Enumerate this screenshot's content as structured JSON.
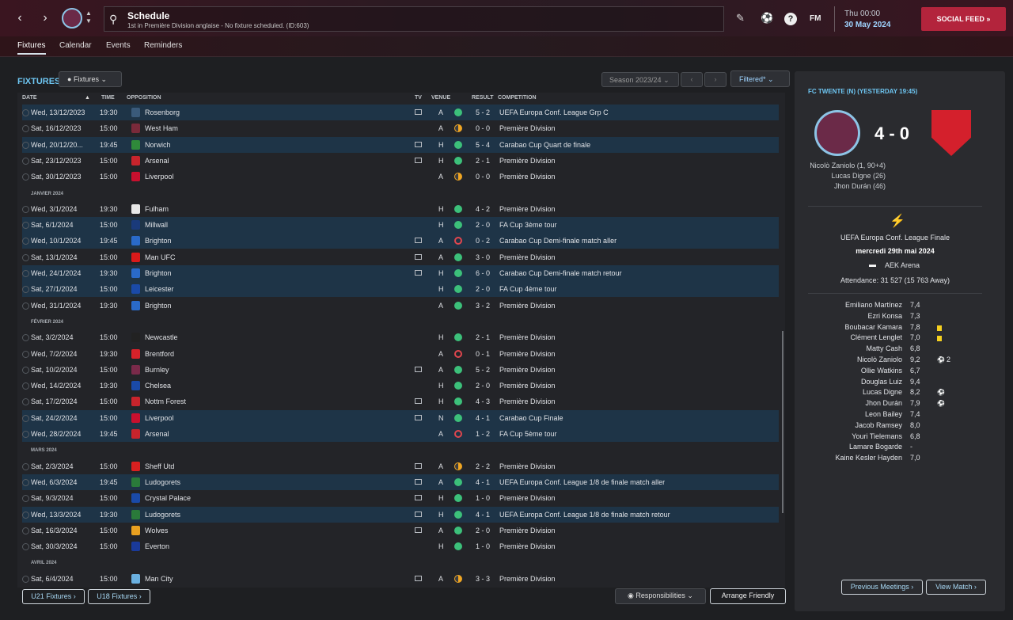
{
  "header": {
    "title": "Schedule",
    "subtitle": "1st in Première Division anglaise - No fixture scheduled. (ID:603)",
    "time": "Thu 00:00",
    "date": "30 May 2024",
    "social_feed": "SOCIAL FEED",
    "fm": "FM",
    "help": "?"
  },
  "tabs": [
    "Fixtures",
    "Calendar",
    "Events",
    "Reminders"
  ],
  "fixtures": {
    "title": "FIXTURES",
    "dropdown": "Fixtures",
    "season": "Season 2023/24",
    "filtered": "Filtered*",
    "columns": [
      "DATE",
      "TIME",
      "OPPOSITION",
      "TV",
      "VENUE",
      "RESULT",
      "COMPETITION"
    ],
    "rows": [
      {
        "date": "Wed, 13/12/2023",
        "time": "19:30",
        "opp": "Rosenborg",
        "tv": true,
        "venue": "A",
        "res": "w",
        "score": "5 - 2",
        "comp": "UEFA Europa Conf. League Grp C",
        "hl": true,
        "badge": "#3a5a7a"
      },
      {
        "date": "Sat, 16/12/2023",
        "time": "15:00",
        "opp": "West Ham",
        "tv": false,
        "venue": "A",
        "res": "d",
        "score": "0 - 0",
        "comp": "Première Division",
        "hl": false,
        "badge": "#7a2a3a"
      },
      {
        "date": "Wed, 20/12/20...",
        "time": "19:45",
        "opp": "Norwich",
        "tv": true,
        "venue": "H",
        "res": "w",
        "score": "5 - 4",
        "comp": "Carabao Cup Quart de finale",
        "hl": true,
        "badge": "#2f8a3a"
      },
      {
        "date": "Sat, 23/12/2023",
        "time": "15:00",
        "opp": "Arsenal",
        "tv": true,
        "venue": "H",
        "res": "w",
        "score": "2 - 1",
        "comp": "Première Division",
        "hl": false,
        "badge": "#c8242c"
      },
      {
        "date": "Sat, 30/12/2023",
        "time": "15:00",
        "opp": "Liverpool",
        "tv": false,
        "venue": "A",
        "res": "d",
        "score": "0 - 0",
        "comp": "Première Division",
        "hl": false,
        "badge": "#c8102e"
      },
      {
        "section": "JANVIER 2024"
      },
      {
        "date": "Wed, 3/1/2024",
        "time": "19:30",
        "opp": "Fulham",
        "tv": false,
        "venue": "H",
        "res": "w",
        "score": "4 - 2",
        "comp": "Première Division",
        "hl": false,
        "badge": "#e8e8e8"
      },
      {
        "date": "Sat, 6/1/2024",
        "time": "15:00",
        "opp": "Millwall",
        "tv": false,
        "venue": "H",
        "res": "w",
        "score": "2 - 0",
        "comp": "FA Cup 3ème tour",
        "hl": true,
        "badge": "#1a3a7a"
      },
      {
        "date": "Wed, 10/1/2024",
        "time": "19:45",
        "opp": "Brighton",
        "tv": true,
        "venue": "A",
        "res": "l",
        "score": "0 - 2",
        "comp": "Carabao Cup Demi-finale match aller",
        "hl": true,
        "badge": "#2a6ac8"
      },
      {
        "date": "Sat, 13/1/2024",
        "time": "15:00",
        "opp": "Man UFC",
        "tv": true,
        "venue": "A",
        "res": "w",
        "score": "3 - 0",
        "comp": "Première Division",
        "hl": false,
        "badge": "#da1a1a"
      },
      {
        "date": "Wed, 24/1/2024",
        "time": "19:30",
        "opp": "Brighton",
        "tv": true,
        "venue": "H",
        "res": "w",
        "score": "6 - 0",
        "comp": "Carabao Cup Demi-finale match retour",
        "hl": true,
        "badge": "#2a6ac8"
      },
      {
        "date": "Sat, 27/1/2024",
        "time": "15:00",
        "opp": "Leicester",
        "tv": false,
        "venue": "H",
        "res": "w",
        "score": "2 - 0",
        "comp": "FA Cup 4ème tour",
        "hl": true,
        "badge": "#1a4aa8"
      },
      {
        "date": "Wed, 31/1/2024",
        "time": "19:30",
        "opp": "Brighton",
        "tv": false,
        "venue": "A",
        "res": "w",
        "score": "3 - 2",
        "comp": "Première Division",
        "hl": false,
        "badge": "#2a6ac8"
      },
      {
        "section": "FÉVRIER 2024"
      },
      {
        "date": "Sat, 3/2/2024",
        "time": "15:00",
        "opp": "Newcastle",
        "tv": false,
        "venue": "H",
        "res": "w",
        "score": "2 - 1",
        "comp": "Première Division",
        "hl": false,
        "badge": "#222222"
      },
      {
        "date": "Wed, 7/2/2024",
        "time": "19:30",
        "opp": "Brentford",
        "tv": false,
        "venue": "A",
        "res": "l",
        "score": "0 - 1",
        "comp": "Première Division",
        "hl": false,
        "badge": "#d8222a"
      },
      {
        "date": "Sat, 10/2/2024",
        "time": "15:00",
        "opp": "Burnley",
        "tv": true,
        "venue": "A",
        "res": "w",
        "score": "5 - 2",
        "comp": "Première Division",
        "hl": false,
        "badge": "#7a2a4a"
      },
      {
        "date": "Wed, 14/2/2024",
        "time": "19:30",
        "opp": "Chelsea",
        "tv": false,
        "venue": "H",
        "res": "w",
        "score": "2 - 0",
        "comp": "Première Division",
        "hl": false,
        "badge": "#1a4aa8"
      },
      {
        "date": "Sat, 17/2/2024",
        "time": "15:00",
        "opp": "Nottm Forest",
        "tv": true,
        "venue": "H",
        "res": "w",
        "score": "4 - 3",
        "comp": "Première Division",
        "hl": false,
        "badge": "#c8242c"
      },
      {
        "date": "Sat, 24/2/2024",
        "time": "15:00",
        "opp": "Liverpool",
        "tv": true,
        "venue": "N",
        "res": "w",
        "score": "4 - 1",
        "comp": "Carabao Cup Finale",
        "hl": true,
        "badge": "#c8102e"
      },
      {
        "date": "Wed, 28/2/2024",
        "time": "19:45",
        "opp": "Arsenal",
        "tv": false,
        "venue": "A",
        "res": "l",
        "score": "1 - 2",
        "comp": "FA Cup 5ème tour",
        "hl": true,
        "badge": "#c8242c"
      },
      {
        "section": "MARS 2024"
      },
      {
        "date": "Sat, 2/3/2024",
        "time": "15:00",
        "opp": "Sheff Utd",
        "tv": true,
        "venue": "A",
        "res": "d",
        "score": "2 - 2",
        "comp": "Première Division",
        "hl": false,
        "badge": "#d82020"
      },
      {
        "date": "Wed, 6/3/2024",
        "time": "19:45",
        "opp": "Ludogorets",
        "tv": true,
        "venue": "A",
        "res": "w",
        "score": "4 - 1",
        "comp": "UEFA Europa Conf. League 1/8 de finale match aller",
        "hl": true,
        "badge": "#2a7a3a"
      },
      {
        "date": "Sat, 9/3/2024",
        "time": "15:00",
        "opp": "Crystal Palace",
        "tv": true,
        "venue": "H",
        "res": "w",
        "score": "1 - 0",
        "comp": "Première Division",
        "hl": false,
        "badge": "#1a4aa8"
      },
      {
        "date": "Wed, 13/3/2024",
        "time": "19:30",
        "opp": "Ludogorets",
        "tv": true,
        "venue": "H",
        "res": "w",
        "score": "4 - 1",
        "comp": "UEFA Europa Conf. League 1/8 de finale match retour",
        "hl": true,
        "badge": "#2a7a3a"
      },
      {
        "date": "Sat, 16/3/2024",
        "time": "15:00",
        "opp": "Wolves",
        "tv": true,
        "venue": "A",
        "res": "w",
        "score": "2 - 0",
        "comp": "Première Division",
        "hl": false,
        "badge": "#e8a020"
      },
      {
        "date": "Sat, 30/3/2024",
        "time": "15:00",
        "opp": "Everton",
        "tv": false,
        "venue": "H",
        "res": "w",
        "score": "1 - 0",
        "comp": "Première Division",
        "hl": false,
        "badge": "#1a3a9a"
      },
      {
        "section": "AVRIL 2024"
      },
      {
        "date": "Sat, 6/4/2024",
        "time": "15:00",
        "opp": "Man City",
        "tv": true,
        "venue": "A",
        "res": "d",
        "score": "3 - 3",
        "comp": "Première Division",
        "hl": false,
        "badge": "#6ab0e0"
      }
    ]
  },
  "bottom": {
    "u21": "U21 Fixtures",
    "u18": "U18 Fixtures",
    "responsibilities": "Responsibilities",
    "arrange": "Arrange Friendly"
  },
  "match": {
    "title": "FC TWENTE (N) (YESTERDAY 19:45)",
    "score": "4 - 0",
    "scorers": [
      "Nicolò Zaniolo (1, 90+4)",
      "Lucas Digne (26)",
      "Jhon Durán (46)"
    ],
    "competition": "UEFA Europa Conf. League Finale",
    "date": "mercredi 29th mai 2024",
    "venue": "AEK Arena",
    "attendance": "Attendance: 31 527 (15 763 Away)",
    "previous": "Previous Meetings",
    "view": "View Match",
    "players": [
      {
        "name": "Emiliano Martínez",
        "rating": "7,4",
        "mark": ""
      },
      {
        "name": "Ezri Konsa",
        "rating": "7,3",
        "mark": ""
      },
      {
        "name": "Boubacar Kamara",
        "rating": "7,8",
        "mark": "yellow"
      },
      {
        "name": "Clément Lenglet",
        "rating": "7,0",
        "mark": "yellow"
      },
      {
        "name": "Matty Cash",
        "rating": "6,8",
        "mark": ""
      },
      {
        "name": "Nicolò Zaniolo",
        "rating": "9,2",
        "mark": "goal2"
      },
      {
        "name": "Ollie Watkins",
        "rating": "6,7",
        "mark": ""
      },
      {
        "name": "Douglas Luiz",
        "rating": "9,4",
        "mark": ""
      },
      {
        "name": "Lucas Digne",
        "rating": "8,2",
        "mark": "goal"
      },
      {
        "name": "Jhon Durán",
        "rating": "7,9",
        "mark": "goal"
      },
      {
        "name": "Leon Bailey",
        "rating": "7,4",
        "mark": ""
      },
      {
        "name": "Jacob Ramsey",
        "rating": "8,0",
        "mark": ""
      },
      {
        "name": "Youri Tielemans",
        "rating": "6,8",
        "mark": ""
      },
      {
        "name": "Lamare Bogarde",
        "rating": "-",
        "mark": ""
      },
      {
        "name": "Kaine Kesler Hayden",
        "rating": "7,0",
        "mark": ""
      }
    ],
    "goal_count": "2"
  },
  "colors": {
    "accent": "#6ec6f2",
    "win": "#3cc07a",
    "draw": "#f0a623",
    "loss": "#e0464e",
    "social": "#b3243c"
  }
}
